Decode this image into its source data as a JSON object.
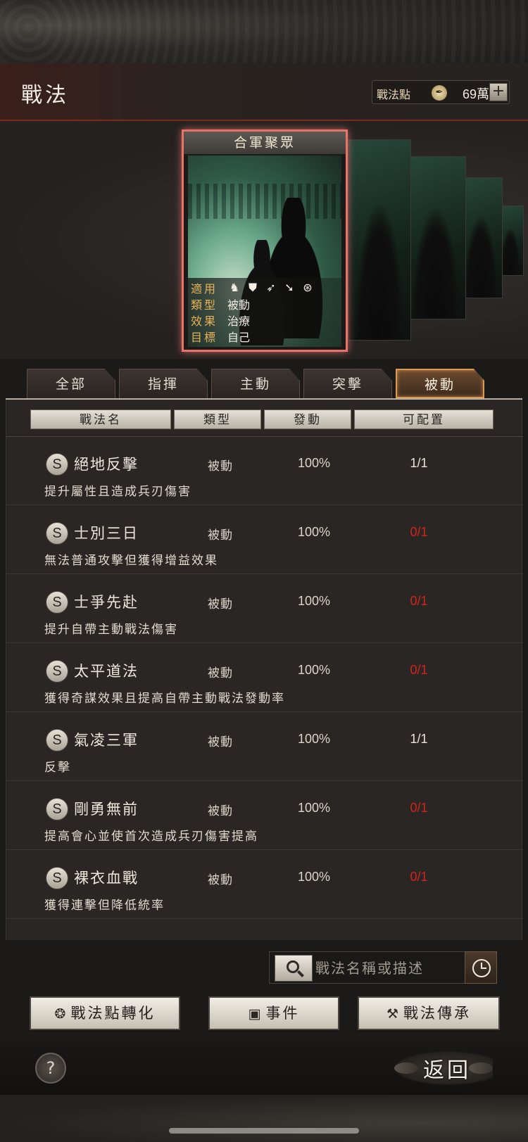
{
  "header": {
    "title": "戰法",
    "points_label": "戰法點",
    "points_value": "69萬",
    "plus": "+"
  },
  "featured_card": {
    "title": "合軍聚眾",
    "info": [
      {
        "key": "適用",
        "value": ""
      },
      {
        "key": "類型",
        "value": "被動"
      },
      {
        "key": "效果",
        "value": "治療"
      },
      {
        "key": "目標",
        "value": "自己"
      }
    ],
    "applicable_icons": [
      "cavalry-icon",
      "shield-icon",
      "bow-icon",
      "spear-icon",
      "wheel-icon"
    ]
  },
  "tabs": [
    {
      "label": "全部",
      "active": false
    },
    {
      "label": "指揮",
      "active": false
    },
    {
      "label": "主動",
      "active": false
    },
    {
      "label": "突擊",
      "active": false
    },
    {
      "label": "被動",
      "active": true
    }
  ],
  "columns": [
    "戰法名",
    "類型",
    "發動",
    "可配置"
  ],
  "tactics": [
    {
      "grade": "S",
      "name": "絕地反擊",
      "type": "被動",
      "rate": "100%",
      "capacity": "1/1",
      "available": true,
      "desc": "提升屬性且造成兵刃傷害"
    },
    {
      "grade": "S",
      "name": "士別三日",
      "type": "被動",
      "rate": "100%",
      "capacity": "0/1",
      "available": false,
      "desc": "無法普通攻擊但獲得增益效果"
    },
    {
      "grade": "S",
      "name": "士爭先赴",
      "type": "被動",
      "rate": "100%",
      "capacity": "0/1",
      "available": false,
      "desc": "提升自帶主動戰法傷害"
    },
    {
      "grade": "S",
      "name": "太平道法",
      "type": "被動",
      "rate": "100%",
      "capacity": "0/1",
      "available": false,
      "desc": "獲得奇謀效果且提高自帶主動戰法發動率"
    },
    {
      "grade": "S",
      "name": "氣凌三軍",
      "type": "被動",
      "rate": "100%",
      "capacity": "1/1",
      "available": true,
      "desc": "反擊"
    },
    {
      "grade": "S",
      "name": "剛勇無前",
      "type": "被動",
      "rate": "100%",
      "capacity": "0/1",
      "available": false,
      "desc": "提高會心並使首次造成兵刃傷害提高"
    },
    {
      "grade": "S",
      "name": "裸衣血戰",
      "type": "被動",
      "rate": "100%",
      "capacity": "0/1",
      "available": false,
      "desc": "獲得連擊但降低統率"
    }
  ],
  "search": {
    "placeholder": "戰法名稱或描述"
  },
  "actions": {
    "convert_label": "戰法點轉化",
    "events_label": "事件",
    "inherit_label": "戰法傳承"
  },
  "footer": {
    "help": "?",
    "back_label": "返回"
  },
  "colors": {
    "accent_red": "#d3241e",
    "card_border": "#e8736a",
    "tab_active_border": "#d99b54",
    "info_key": "#e6b25b"
  }
}
